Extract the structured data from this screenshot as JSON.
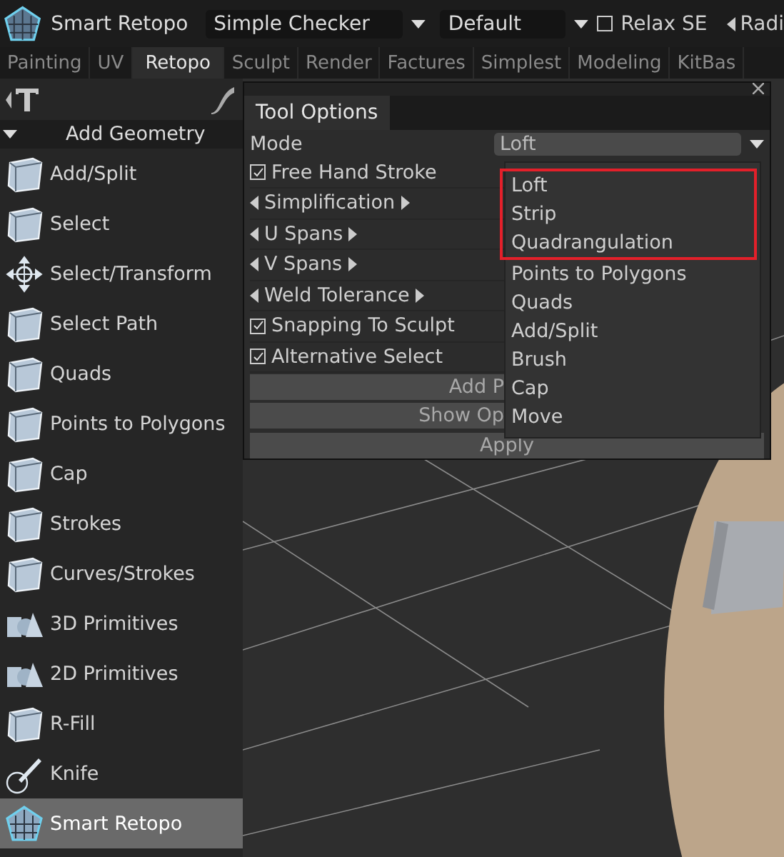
{
  "toolbar": {
    "tool": "Smart Retopo",
    "checker": "Simple Checker",
    "preset": "Default",
    "relax": {
      "label": "Relax SE",
      "checked": false
    },
    "cut_label": "Radi"
  },
  "tabs": [
    {
      "label": "Painting",
      "selected": false
    },
    {
      "label": "UV",
      "selected": false
    },
    {
      "label": "Retopo",
      "selected": true
    },
    {
      "label": "Sculpt",
      "selected": false
    },
    {
      "label": "Render",
      "selected": false
    },
    {
      "label": "Factures",
      "selected": false
    },
    {
      "label": "Simplest",
      "selected": false
    },
    {
      "label": "Modeling",
      "selected": false
    },
    {
      "label": "KitBas",
      "selected": false
    }
  ],
  "sidebar": {
    "section": "Add Geometry",
    "items": [
      {
        "label": "Add/Split",
        "selected": false
      },
      {
        "label": "Select",
        "selected": false
      },
      {
        "label": "Select/Transform",
        "selected": false
      },
      {
        "label": "Select Path",
        "selected": false
      },
      {
        "label": "Quads",
        "selected": false
      },
      {
        "label": "Points to Polygons",
        "selected": false
      },
      {
        "label": "Cap",
        "selected": false
      },
      {
        "label": "Strokes",
        "selected": false
      },
      {
        "label": "Curves/Strokes",
        "selected": false
      },
      {
        "label": "3D Primitives",
        "selected": false
      },
      {
        "label": "2D Primitives",
        "selected": false
      },
      {
        "label": "R-Fill",
        "selected": false
      },
      {
        "label": "Knife",
        "selected": false
      },
      {
        "label": "Smart Retopo",
        "selected": true
      }
    ]
  },
  "tool_options": {
    "tab": "Tool Options",
    "mode_label": "Mode",
    "mode_value": "Loft",
    "rows": [
      {
        "kind": "checkbox",
        "label": "Free Hand Stroke",
        "checked": true
      },
      {
        "kind": "slider",
        "label": "Simplification"
      },
      {
        "kind": "slider",
        "label": "U Spans"
      },
      {
        "kind": "slider",
        "label": "V Spans"
      },
      {
        "kind": "slider",
        "label": "Weld Tolerance"
      },
      {
        "kind": "checkbox",
        "label": "Snapping To Sculpt",
        "checked": true
      },
      {
        "kind": "checkbox",
        "label": "Alternative Select",
        "checked": true
      },
      {
        "kind": "button",
        "label": "Add P"
      },
      {
        "kind": "button",
        "label": "Show Op"
      }
    ],
    "apply": "Apply",
    "dropdown": [
      {
        "label": "Loft",
        "highlighted": true
      },
      {
        "label": "Strip",
        "highlighted": true
      },
      {
        "label": "Quadrangulation",
        "highlighted": true
      },
      {
        "label": "Points to Polygons",
        "highlighted": false
      },
      {
        "label": "Quads",
        "highlighted": false
      },
      {
        "label": "Add/Split",
        "highlighted": false
      },
      {
        "label": "Brush",
        "highlighted": false
      },
      {
        "label": "Cap",
        "highlighted": false
      },
      {
        "label": "Move",
        "highlighted": false
      }
    ]
  }
}
